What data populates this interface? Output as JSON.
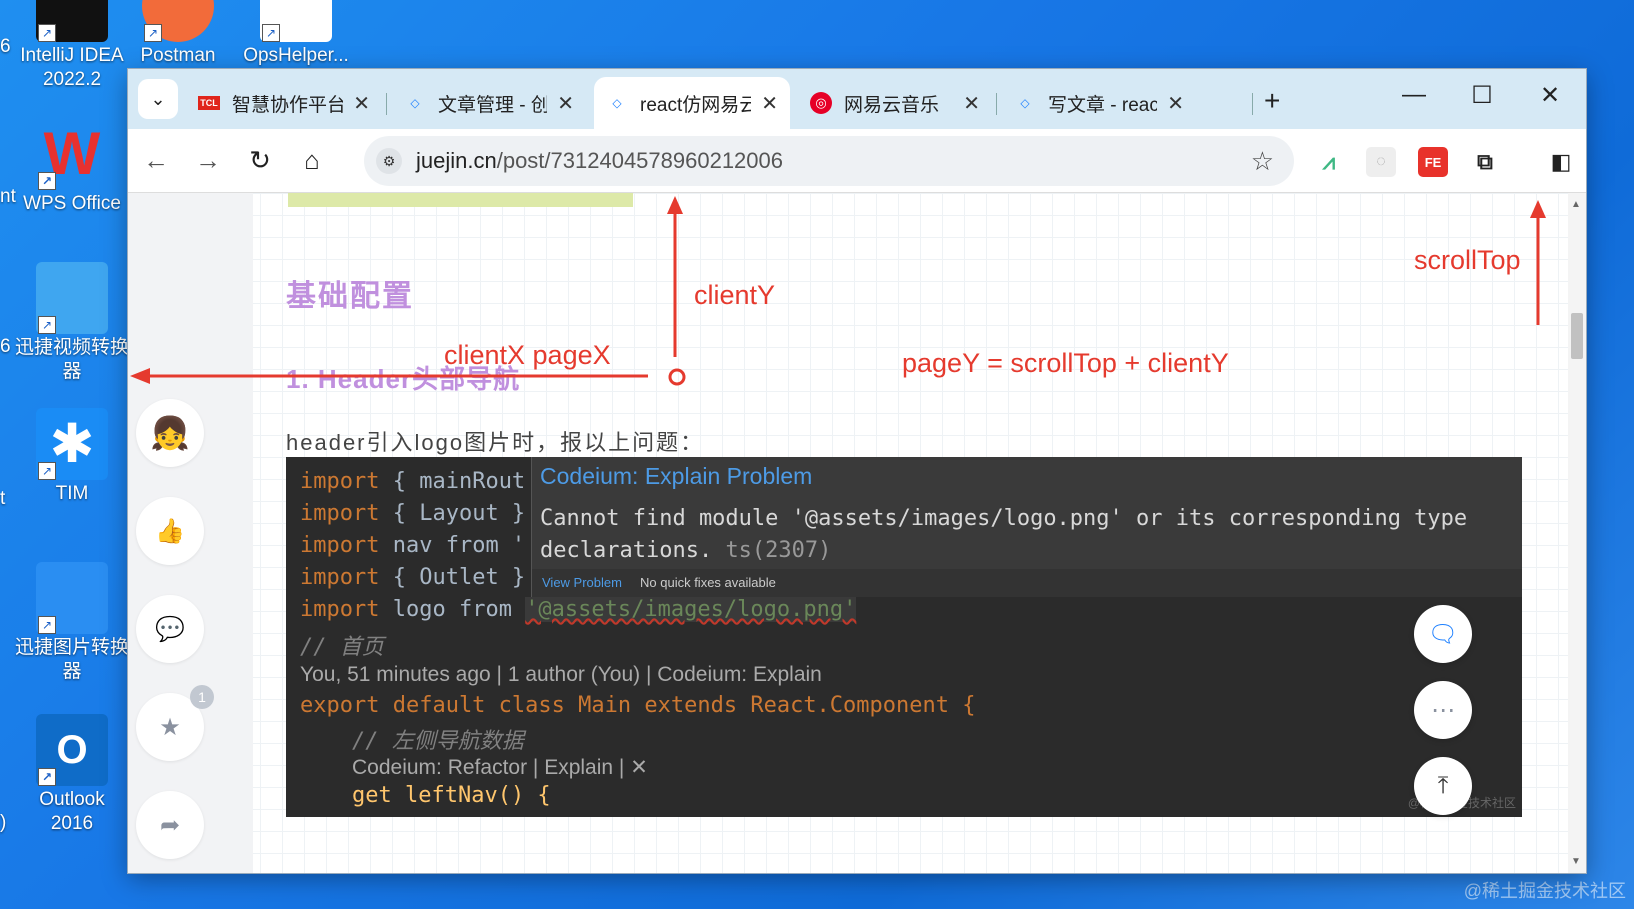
{
  "desktop": {
    "icons": [
      {
        "label_lines": [
          "IntelliJ IDEA",
          "2022.2"
        ]
      },
      {
        "label_lines": [
          "Postman"
        ]
      },
      {
        "label_lines": [
          "OpsHelper..."
        ]
      },
      {
        "label_lines": [
          "WPS Office"
        ]
      },
      {
        "label_lines": [
          "迅捷视频转换",
          "器"
        ]
      },
      {
        "label_lines": [
          "TIM"
        ]
      },
      {
        "label_lines": [
          "迅捷图片转换",
          "器"
        ]
      },
      {
        "label_lines": [
          "Outlook",
          "2016"
        ]
      }
    ],
    "left_fragments": [
      "6",
      "nt",
      "6",
      "t",
      "",
      "6",
      "",
      ")"
    ],
    "watermark": "@稀土掘金技术社区"
  },
  "browser": {
    "tabs": [
      {
        "title": "智慧协作平台",
        "favicon": "tcl-logo",
        "favicon_text": "TCL",
        "active": false
      },
      {
        "title": "文章管理 - 创",
        "favicon": "juejin-logo",
        "active": false
      },
      {
        "title": "react仿网易云",
        "favicon": "juejin-logo",
        "active": true
      },
      {
        "title": "网易云音乐",
        "favicon": "netease-music-logo",
        "active": false
      },
      {
        "title": "写文章 - reac",
        "favicon": "juejin-logo",
        "active": false
      }
    ],
    "new_tab": "+",
    "window_controls": {
      "minimize": "—",
      "maximize": "☐",
      "close": "✕"
    },
    "url_host": "juejin.cn",
    "url_path": "/post/7312404578960212006",
    "extensions": [
      "vue-devtools-icon",
      "ext-gray-icon",
      "fe-helper-icon",
      "puzzle-icon",
      "sidepanel-icon",
      "profile-avatar",
      "kebab-menu-icon"
    ]
  },
  "article": {
    "heading_base": "基础配置",
    "heading_header": "1. Header头部导航",
    "paragraph": "header引入logo图片时，报以上问题：",
    "like_badge": "1"
  },
  "code": {
    "lines": [
      {
        "kw": "import",
        "rest": " { mainRout"
      },
      {
        "kw": "import",
        "rest": " { Layout }"
      },
      {
        "kw": "import",
        "rest": " nav from '"
      },
      {
        "kw": "import",
        "rest": " { Outlet }"
      },
      {
        "kw": "import",
        "mid": " logo from ",
        "str": "'@assets/images/logo.png'"
      },
      {
        "comment": "// 首页"
      },
      {
        "lens": "You, 51 minutes ago | 1 author (You) | Codeium: Explain"
      },
      {
        "export": "export default class Main extends React.Component {"
      },
      {
        "comment": "// 左侧导航数据"
      },
      {
        "lens": "Codeium: Refactor | Explain | ✕"
      },
      {
        "getter": "get leftNav() {"
      }
    ],
    "tooltip": {
      "title": "Codeium: Explain Problem",
      "message_line1": "Cannot find module '@assets/images/logo.png' or its corresponding type",
      "message_line2": "declarations.",
      "code": "ts(2307)",
      "view_problem": "View Problem",
      "no_fixes": "No quick fixes available"
    },
    "watermark": "@稀土掘金技术社区"
  },
  "annotations": {
    "clientY": "clientY",
    "scrollTop": "scrollTop",
    "clientX_pageX": "clientX pageX",
    "pageY_formula": "pageY = scrollTop + clientY",
    "color": "#e53a2e"
  }
}
